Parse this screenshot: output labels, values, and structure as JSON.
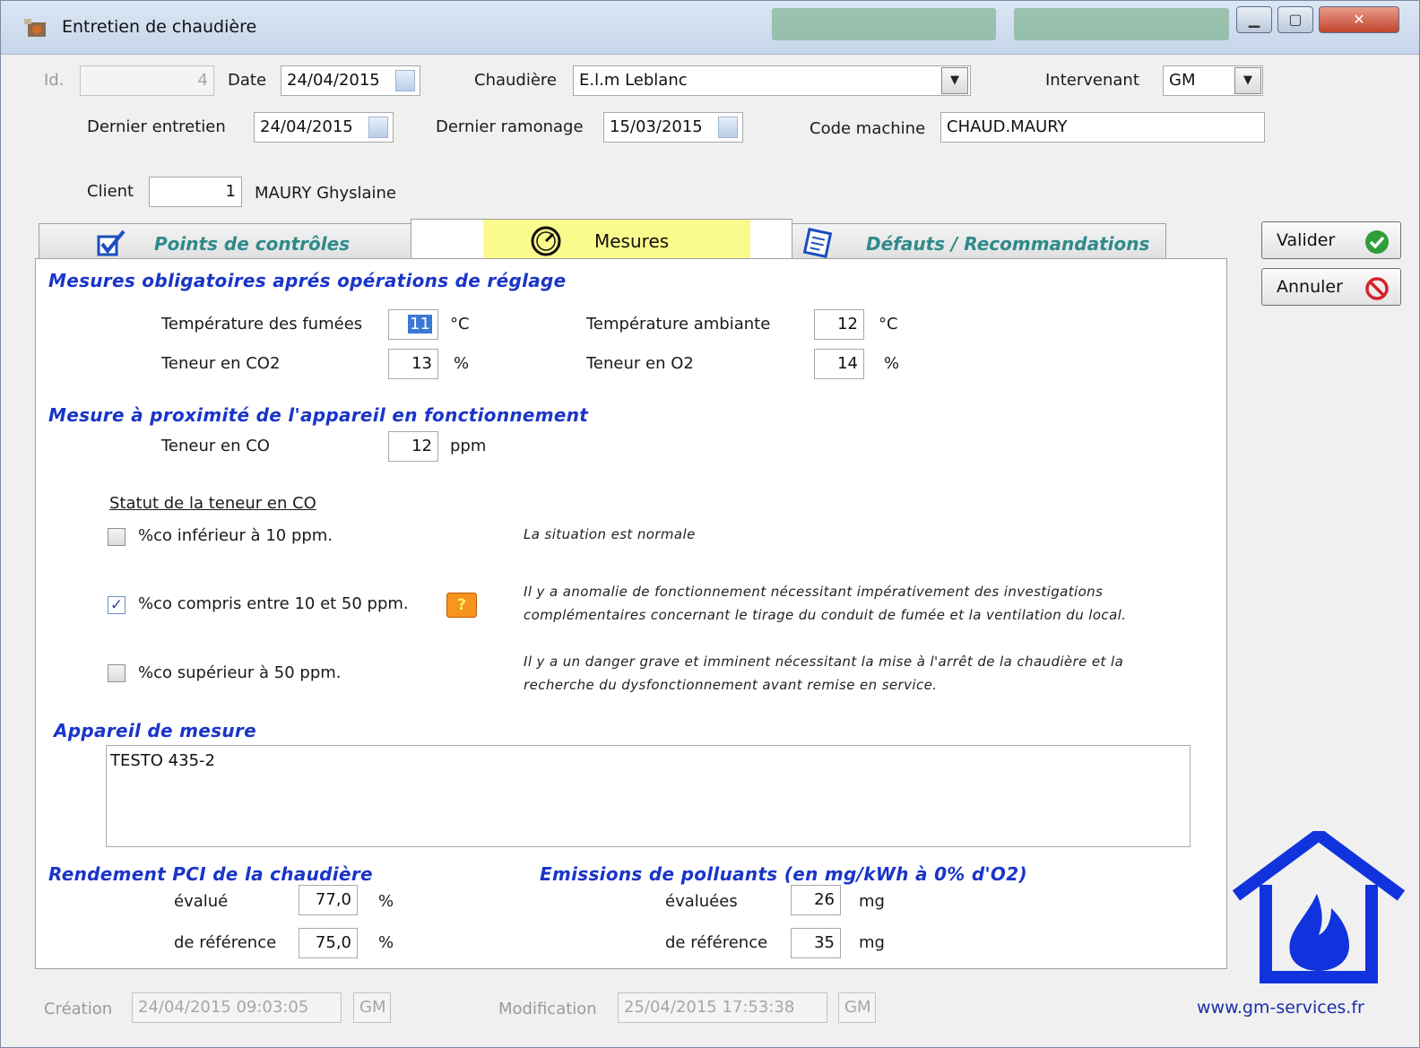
{
  "window": {
    "title": "Entretien de chaudière"
  },
  "header": {
    "id_label": "Id.",
    "id_value": "4",
    "date_label": "Date",
    "date_value": "24/04/2015",
    "chaudiere_label": "Chaudière",
    "chaudiere_value": "E.l.m Leblanc",
    "intervenant_label": "Intervenant",
    "intervenant_value": "GM",
    "dernier_entretien_label": "Dernier entretien",
    "dernier_entretien_value": "24/04/2015",
    "dernier_ramonage_label": "Dernier ramonage",
    "dernier_ramonage_value": "15/03/2015",
    "code_machine_label": "Code machine",
    "code_machine_value": "CHAUD.MAURY",
    "client_label": "Client",
    "client_id": "1",
    "client_name": "MAURY Ghyslaine"
  },
  "tabs": [
    {
      "label": "Points de contrôles",
      "active": false
    },
    {
      "label": "Mesures",
      "active": true
    },
    {
      "label": "Défauts / Recommandations",
      "active": false
    }
  ],
  "buttons": {
    "valider": "Valider",
    "annuler": "Annuler"
  },
  "mesures": {
    "section1_title": "Mesures obligatoires aprés opérations de réglage",
    "temp_fumees_label": "Température des fumées",
    "temp_fumees_value": "11",
    "temp_fumees_unit": "°C",
    "temp_ambiante_label": "Température ambiante",
    "temp_ambiante_value": "12",
    "temp_ambiante_unit": "°C",
    "co2_label": "Teneur en CO2",
    "co2_value": "13",
    "co2_unit": "%",
    "o2_label": "Teneur en O2",
    "o2_value": "14",
    "o2_unit": "%",
    "section2_title": "Mesure à proximité de l'appareil en fonctionnement",
    "co_label": "Teneur en CO",
    "co_value": "12",
    "co_unit": "ppm",
    "statut_title": "Statut de la teneur en CO",
    "statut_options": [
      {
        "label": "%co inférieur à 10 ppm.",
        "checked": false,
        "desc1": "La situation est normale",
        "desc2": ""
      },
      {
        "label": "%co compris entre 10 et 50 ppm.",
        "checked": true,
        "desc1": "Il y a anomalie de fonctionnement nécessitant impérativement des investigations",
        "desc2": "complémentaires concernant le tirage du conduit de fumée et la ventilation du local."
      },
      {
        "label": "%co supérieur à 50 ppm.",
        "checked": false,
        "desc1": "Il y a un danger grave et imminent nécessitant la mise à l'arrêt de la chaudière et la",
        "desc2": "recherche du dysfonctionnement avant remise en service."
      }
    ],
    "appareil_title": "Appareil de mesure",
    "appareil_value": "TESTO 435-2",
    "rendement_title": "Rendement PCI de la chaudière",
    "rendement_evalue_label": "évalué",
    "rendement_evalue_value": "77,0",
    "rendement_unit": "%",
    "rendement_ref_label": "de référence",
    "rendement_ref_value": "75,0",
    "emissions_title": "Emissions de polluants (en mg/kWh à 0% d'O2)",
    "emissions_evaluees_label": "évaluées",
    "emissions_evaluees_value": "26",
    "emissions_unit": "mg",
    "emissions_ref_label": "de référence",
    "emissions_ref_value": "35"
  },
  "footer": {
    "creation_label": "Création",
    "creation_value": "24/04/2015 09:03:05",
    "creation_user": "GM",
    "modification_label": "Modification",
    "modification_value": "25/04/2015 17:53:38",
    "modification_user": "GM",
    "website": "www.gm-services.fr"
  },
  "colors": {
    "section_blue": "#1a35c8",
    "tab_teal": "#2f8a8a",
    "highlight_yellow": "#fbfa8c",
    "logo_blue": "#1133dd"
  }
}
